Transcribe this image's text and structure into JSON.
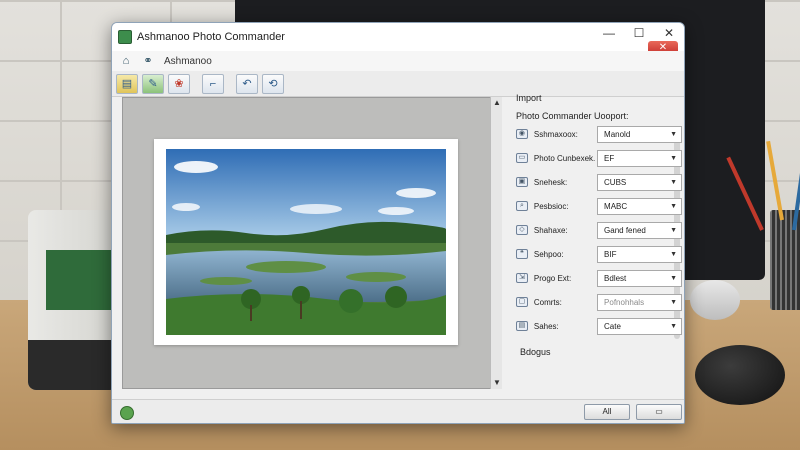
{
  "window": {
    "title": "Ashmanoo Photo Commander",
    "close_glyph": "✕"
  },
  "menubar": {
    "brand": "Ashmanoo"
  },
  "toolbar": {
    "buttons": [
      "open-icon",
      "edit-icon",
      "effects-icon",
      "crop-icon",
      "rotate-left-icon",
      "rotate-right-icon"
    ]
  },
  "panel": {
    "title": "Import",
    "subtitle": "Photo Commander Uooport:",
    "rows": [
      {
        "label": "Sshmaxoox:",
        "value": "Manold",
        "icon": "camera-icon"
      },
      {
        "label": "Photo Cunbexek.",
        "value": "EF",
        "icon": "photo-icon"
      },
      {
        "label": "Snehesk:",
        "value": "CUBS",
        "icon": "save-icon"
      },
      {
        "label": "Pesbsioc:",
        "value": "MABC",
        "icon": "search-icon"
      },
      {
        "label": "Shahaxe:",
        "value": "Gand fened",
        "icon": "tag-icon"
      },
      {
        "label": "Sehpoo:",
        "value": "BIF",
        "icon": "comment-icon"
      },
      {
        "label": "Progo Ext:",
        "value": "Bdlest",
        "icon": "export-icon"
      },
      {
        "label": "Comrts:",
        "value": "Pofnohhals",
        "icon": "folder-icon",
        "disabled": true
      },
      {
        "label": "Sahes:",
        "value": "Cate",
        "icon": "window-icon"
      }
    ],
    "footer": "Bdogus"
  },
  "bottom": {
    "ok_label": "All",
    "cancel_label": "▭"
  }
}
